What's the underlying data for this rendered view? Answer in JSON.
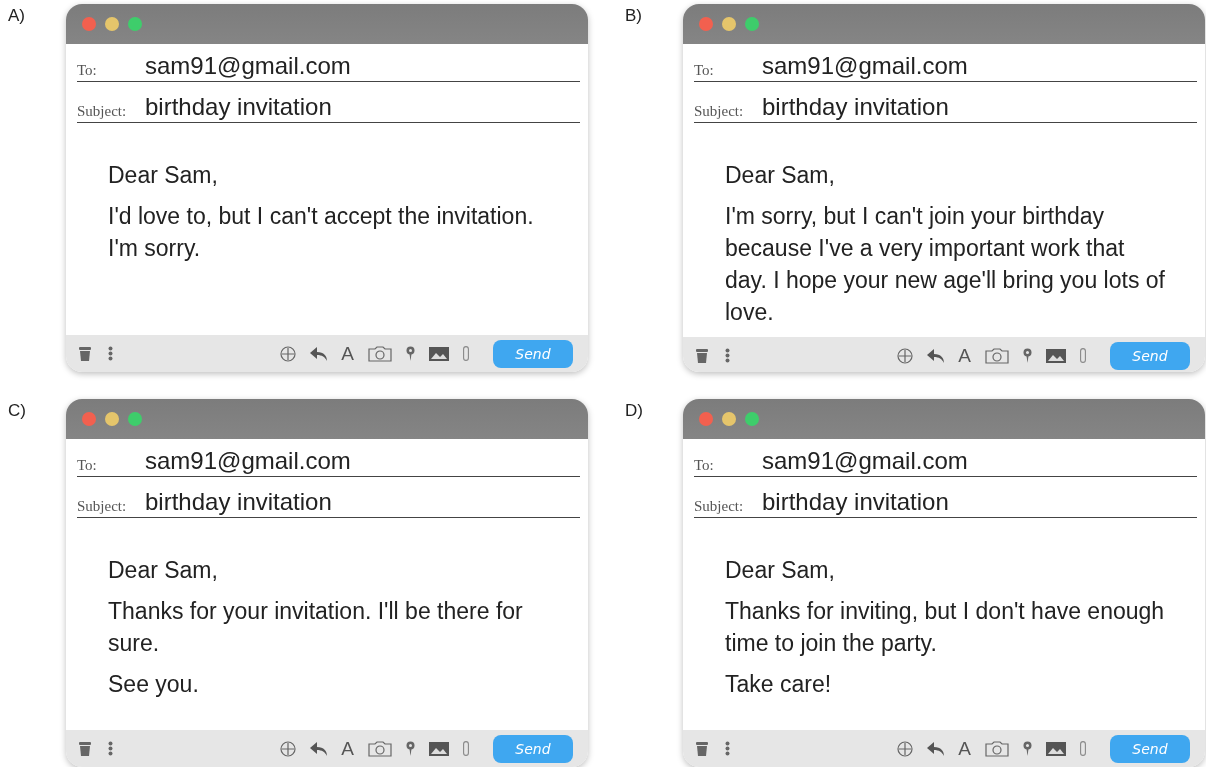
{
  "options": [
    {
      "label": "A)",
      "window": {
        "to_label": "To:",
        "to": "sam91@gmail.com",
        "subject_label": "Subject:",
        "subject": "birthday invitation",
        "body": [
          "Dear Sam,",
          "I'd love to, but I can't accept the invitation. I'm sorry."
        ],
        "font_tool": "A",
        "send": "Send"
      }
    },
    {
      "label": "B)",
      "window": {
        "to_label": "To:",
        "to": "sam91@gmail.com",
        "subject_label": "Subject:",
        "subject": "birthday invitation",
        "body": [
          "Dear Sam,",
          "I'm sorry, but I can't join your birthday because I've a very important work that day. I hope your new age'll bring you lots of love."
        ],
        "font_tool": "A",
        "send": "Send"
      }
    },
    {
      "label": "C)",
      "window": {
        "to_label": "To:",
        "to": "sam91@gmail.com",
        "subject_label": "Subject:",
        "subject": "birthday invitation",
        "body": [
          "Dear Sam,",
          "Thanks for your invitation. I'll be there for sure.",
          "See you."
        ],
        "font_tool": "A",
        "send": "Send"
      }
    },
    {
      "label": "D)",
      "window": {
        "to_label": "To:",
        "to": "sam91@gmail.com",
        "subject_label": "Subject:",
        "subject": "birthday invitation",
        "body": [
          "Dear Sam,",
          "Thanks for inviting, but I don't have enough time to join the party.",
          "Take care!"
        ],
        "font_tool": "A",
        "send": "Send"
      }
    }
  ]
}
